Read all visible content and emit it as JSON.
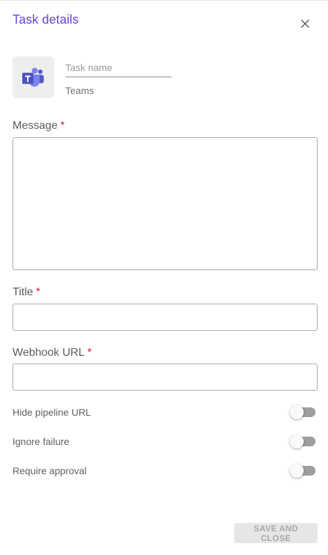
{
  "header": {
    "title": "Task details",
    "close_icon": "close-icon"
  },
  "task": {
    "name_placeholder": "Task name",
    "name_value": "",
    "app_name": "Teams",
    "app_icon": "microsoft-teams-icon"
  },
  "form": {
    "message": {
      "label": "Message",
      "required_mark": "*",
      "value": ""
    },
    "title": {
      "label": "Title",
      "required_mark": "*",
      "value": ""
    },
    "webhook_url": {
      "label": "Webhook URL",
      "required_mark": "*",
      "value": ""
    }
  },
  "toggles": [
    {
      "label": "Hide pipeline URL",
      "checked": false
    },
    {
      "label": "Ignore failure",
      "checked": false
    },
    {
      "label": "Require approval",
      "checked": false
    }
  ],
  "footer": {
    "save_label": "SAVE AND CLOSE",
    "save_disabled": true
  },
  "colors": {
    "title": "#6a3fe0",
    "required": "#d21f2f",
    "teams_purple": "#5059c9",
    "teams_purple_dark": "#4b53bc",
    "teams_purple_light": "#7b83eb"
  }
}
